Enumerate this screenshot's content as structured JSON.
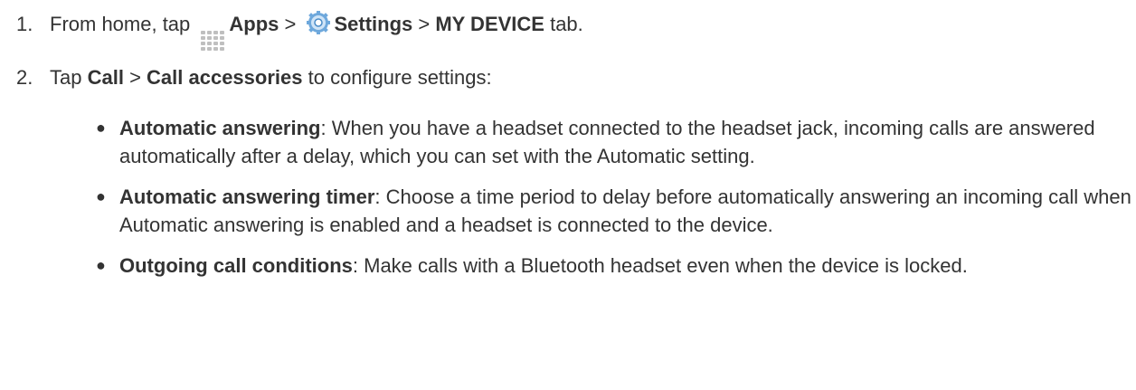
{
  "steps": [
    {
      "num": "1.",
      "t1": "From home, tap ",
      "apps_icon": "apps-grid-icon",
      "apps": "Apps",
      "sep1": " > ",
      "settings_icon": "settings-gear-icon",
      "settings": "Settings",
      "sep2": " > ",
      "tab": "MY DEVICE",
      "t2": " tab."
    },
    {
      "num": "2.",
      "t1": "Tap ",
      "call": "Call",
      "sep": " > ",
      "accessories": "Call accessories",
      "t2": " to configure settings:"
    }
  ],
  "bullets": [
    {
      "term": "Automatic answering",
      "desc": ": When you have a headset connected to the headset jack, incoming calls are answered automatically after a delay, which you can set with the Automatic setting."
    },
    {
      "term": "Automatic answering timer",
      "desc": ": Choose a time period to delay before automatically answering an incoming call when Automatic answering is enabled and a headset is connected to the device."
    },
    {
      "term": "Outgoing call conditions",
      "desc": ": Make calls with a Bluetooth headset even when the device is locked."
    }
  ]
}
